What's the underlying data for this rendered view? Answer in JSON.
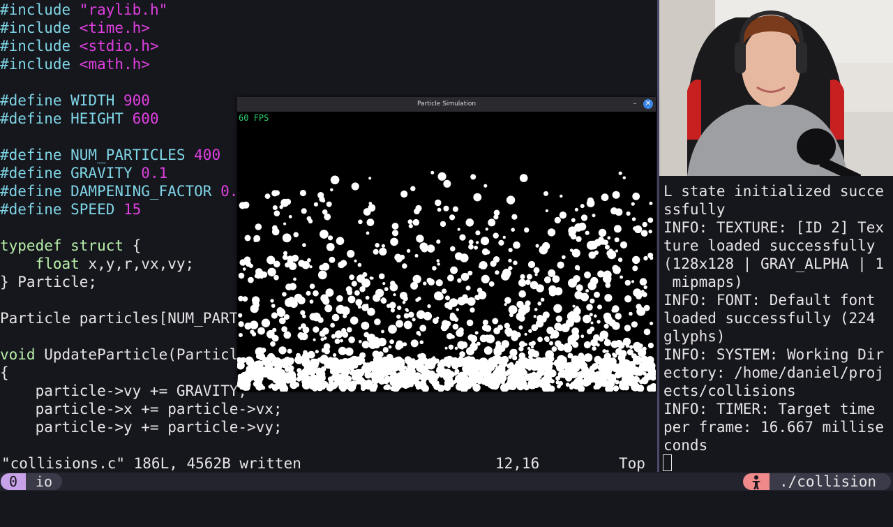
{
  "editor": {
    "lines": [
      {
        "parts": [
          {
            "t": "#include ",
            "c": "pp"
          },
          {
            "t": "\"raylib.h\"",
            "c": "str"
          }
        ]
      },
      {
        "parts": [
          {
            "t": "#include ",
            "c": "pp"
          },
          {
            "t": "<time.h>",
            "c": "str"
          }
        ]
      },
      {
        "parts": [
          {
            "t": "#include ",
            "c": "pp"
          },
          {
            "t": "<stdio.h>",
            "c": "str"
          }
        ]
      },
      {
        "parts": [
          {
            "t": "#include ",
            "c": "pp"
          },
          {
            "t": "<math.h>",
            "c": "str"
          }
        ]
      },
      {
        "parts": []
      },
      {
        "parts": [
          {
            "t": "#define WIDTH ",
            "c": "pp"
          },
          {
            "t": "900",
            "c": "num"
          }
        ]
      },
      {
        "parts": [
          {
            "t": "#define HEIGHT ",
            "c": "pp"
          },
          {
            "t": "600",
            "c": "num"
          }
        ]
      },
      {
        "parts": []
      },
      {
        "parts": [
          {
            "t": "#define NUM_PARTICLES ",
            "c": "pp"
          },
          {
            "t": "400",
            "c": "num"
          }
        ]
      },
      {
        "parts": [
          {
            "t": "#define GRAVITY ",
            "c": "pp"
          },
          {
            "t": "0.1",
            "c": "num"
          }
        ]
      },
      {
        "parts": [
          {
            "t": "#define DAMPENING_FACTOR ",
            "c": "pp"
          },
          {
            "t": "0.",
            "c": "num"
          }
        ]
      },
      {
        "parts": [
          {
            "t": "#define SPEED ",
            "c": "pp"
          },
          {
            "t": "15",
            "c": "num"
          }
        ]
      },
      {
        "parts": []
      },
      {
        "parts": [
          {
            "t": "typedef struct ",
            "c": "kw"
          },
          {
            "t": "{",
            "c": ""
          }
        ]
      },
      {
        "parts": [
          {
            "t": "    ",
            "c": ""
          },
          {
            "t": "float",
            "c": "kw"
          },
          {
            "t": " x,y,r,vx,vy;",
            "c": ""
          }
        ]
      },
      {
        "parts": [
          {
            "t": "} Particle;",
            "c": ""
          }
        ]
      },
      {
        "parts": []
      },
      {
        "parts": [
          {
            "t": "Particle particles[NUM_PART",
            "c": ""
          }
        ]
      },
      {
        "parts": []
      },
      {
        "parts": [
          {
            "t": "void",
            "c": "kw"
          },
          {
            "t": " UpdateParticle(Particle",
            "c": ""
          }
        ]
      },
      {
        "parts": [
          {
            "t": "{",
            "c": ""
          }
        ]
      },
      {
        "parts": [
          {
            "t": "    particle->vy += GRAVITY;",
            "c": ""
          }
        ]
      },
      {
        "parts": [
          {
            "t": "    particle->x += particle->vx;",
            "c": ""
          }
        ]
      },
      {
        "parts": [
          {
            "t": "    particle->y += particle->vy;",
            "c": ""
          }
        ]
      }
    ],
    "status_message": "\"collisions.c\" 186L, 4562B written",
    "cursor_position": "12,16",
    "scroll_position": "Top"
  },
  "terminal": {
    "lines": [
      "L state initialized succe",
      "ssfully",
      "INFO: TEXTURE: [ID 2] Tex",
      "ture loaded successfully",
      "(128x128 | GRAY_ALPHA | 1",
      " mipmaps)",
      "INFO: FONT: Default font",
      "loaded successfully (224",
      "glyphs)",
      "INFO: SYSTEM: Working Dir",
      "ectory: /home/daniel/proj",
      "ects/collisions",
      "INFO: TIMER: Target time",
      "per frame: 16.667 millise",
      "conds"
    ]
  },
  "sim_window": {
    "title": "Particle Simulation",
    "minimize_symbol": "–",
    "close_symbol": "✕",
    "fps_text": "60 FPS",
    "particle_color": "#ffffff",
    "fps_color": "#2fd070"
  },
  "tmux": {
    "window_index": "0",
    "window_name": "io",
    "path": "./collision",
    "accent_color": "#c8a2e8",
    "icon_color": "#f08a8a"
  },
  "webcam": {
    "icon": "webcam-video"
  }
}
